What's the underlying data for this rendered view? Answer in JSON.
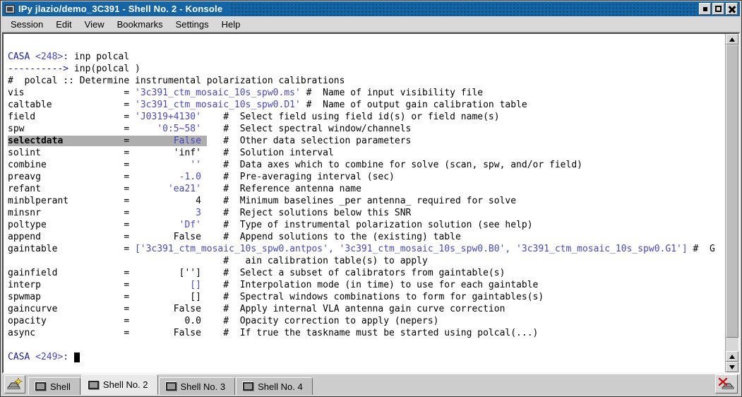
{
  "window": {
    "title": "IPy jlazio/demo_3C391 - Shell No. 2 - Konsole"
  },
  "menu": {
    "items": [
      "Session",
      "Edit",
      "View",
      "Bookmarks",
      "Settings",
      "Help"
    ]
  },
  "colors": {
    "titlebar_blue": "#1565a5",
    "prompt_navy": "#1c1c9e",
    "value_blue": "#4646c8",
    "highlight_gray": "#aeaeae",
    "terminal_bg": "#ffffff"
  },
  "terminal": {
    "lines": [
      {
        "segs": [
          {
            "t": "CASA ",
            "c": "p"
          },
          {
            "t": "<248>",
            "c": "n"
          },
          {
            "t": ": ",
            "c": "p"
          },
          {
            "t": "inp polcal",
            "c": "k"
          }
        ]
      },
      {
        "segs": [
          {
            "t": "----------> ",
            "c": "p"
          },
          {
            "t": "inp(polcal )",
            "c": "k"
          }
        ]
      },
      {
        "segs": [
          {
            "t": "#  polcal :: Determine instrumental polarization calibrations",
            "c": "k"
          }
        ]
      },
      {
        "segs": [
          {
            "t": "vis                  = ",
            "c": "k"
          },
          {
            "t": "'3c391_ctm_mosaic_10s_spw0.ms'",
            "c": "n"
          },
          {
            "t": " #  Name of input visibility file",
            "c": "k"
          }
        ]
      },
      {
        "segs": [
          {
            "t": "caltable             = ",
            "c": "k"
          },
          {
            "t": "'3c391_ctm_mosaic_10s_spw0.D1'",
            "c": "n"
          },
          {
            "t": " #  Name of output gain calibration table",
            "c": "k"
          }
        ]
      },
      {
        "segs": [
          {
            "t": "field                = ",
            "c": "k"
          },
          {
            "t": "'J0319+4130'",
            "c": "n"
          },
          {
            "t": "    #  Select field using field id(s) or field name(s)",
            "c": "k"
          }
        ]
      },
      {
        "segs": [
          {
            "t": "spw                  =     ",
            "c": "k"
          },
          {
            "t": "'0:5~58'",
            "c": "n"
          },
          {
            "t": "    #  Select spectral window/channels",
            "c": "k"
          }
        ]
      },
      {
        "segs": [
          {
            "t": "selectdata           ",
            "c": "b hl"
          },
          {
            "t": "=        ",
            "c": "k hl"
          },
          {
            "t": "False",
            "c": "n hl"
          },
          {
            "t": " ",
            "c": "k hl"
          },
          {
            "t": "   #  Other data selection parameters",
            "c": "k"
          }
        ]
      },
      {
        "segs": [
          {
            "t": "solint               =        'inf'    #  Solution interval",
            "c": "k"
          }
        ]
      },
      {
        "segs": [
          {
            "t": "combine              =           ",
            "c": "k"
          },
          {
            "t": "''",
            "c": "n"
          },
          {
            "t": "    #  Data axes which to combine for solve (scan, spw, and/or field)",
            "c": "k"
          }
        ]
      },
      {
        "segs": [
          {
            "t": "preavg               =         ",
            "c": "k"
          },
          {
            "t": "-1.0",
            "c": "n"
          },
          {
            "t": "    #  Pre-averaging interval (sec)",
            "c": "k"
          }
        ]
      },
      {
        "segs": [
          {
            "t": "refant               =       ",
            "c": "k"
          },
          {
            "t": "'ea21'",
            "c": "n"
          },
          {
            "t": "    #  Reference antenna name",
            "c": "k"
          }
        ]
      },
      {
        "segs": [
          {
            "t": "minblperant          =            4    #  Minimum baselines _per antenna_ required for solve",
            "c": "k"
          }
        ]
      },
      {
        "segs": [
          {
            "t": "minsnr               =            ",
            "c": "k"
          },
          {
            "t": "3",
            "c": "n"
          },
          {
            "t": "    #  Reject solutions below this SNR",
            "c": "k"
          }
        ]
      },
      {
        "segs": [
          {
            "t": "poltype              =         ",
            "c": "k"
          },
          {
            "t": "'Df'",
            "c": "n"
          },
          {
            "t": "    #  Type of instrumental polarization solution (see help)",
            "c": "k"
          }
        ]
      },
      {
        "segs": [
          {
            "t": "append               =        False    #  Append solutions to the (existing) table",
            "c": "k"
          }
        ]
      },
      {
        "segs": [
          {
            "t": "gaintable            = ",
            "c": "k"
          },
          {
            "t": "['3c391_ctm_mosaic_10s_spw0.antpos', '3c391_ctm_mosaic_10s_spw0.B0', '3c391_ctm_mosaic_10s_spw0.G1']",
            "c": "n"
          },
          {
            "t": " #  G",
            "c": "k"
          }
        ]
      },
      {
        "segs": [
          {
            "t": "                                       #   ain calibration table(s) to apply",
            "c": "k"
          }
        ]
      },
      {
        "segs": [
          {
            "t": "gainfield            =         ['']    #  Select a subset of calibrators from gaintable(s)",
            "c": "k"
          }
        ]
      },
      {
        "segs": [
          {
            "t": "interp               =           ",
            "c": "k"
          },
          {
            "t": "[]",
            "c": "n"
          },
          {
            "t": "    #  Interpolation mode (in time) to use for each gaintable",
            "c": "k"
          }
        ]
      },
      {
        "segs": [
          {
            "t": "spwmap               =           []    #  Spectral windows combinations to form for gaintables(s)",
            "c": "k"
          }
        ]
      },
      {
        "segs": [
          {
            "t": "gaincurve            =        False    #  Apply internal VLA antenna gain curve correction",
            "c": "k"
          }
        ]
      },
      {
        "segs": [
          {
            "t": "opacity              =          0.0    #  Opacity correction to apply (nepers)",
            "c": "k"
          }
        ]
      },
      {
        "segs": [
          {
            "t": "async                =        False    #  If true the taskname must be started using polcal(...)",
            "c": "k"
          }
        ]
      },
      {
        "segs": [
          {
            "t": " ",
            "c": "k"
          }
        ]
      },
      {
        "cursor": true,
        "segs": [
          {
            "t": "CASA ",
            "c": "p"
          },
          {
            "t": "<249>",
            "c": "n"
          },
          {
            "t": ": ",
            "c": "p"
          }
        ]
      }
    ]
  },
  "tabs": {
    "items": [
      {
        "label": "Shell",
        "active": false
      },
      {
        "label": "Shell No. 2",
        "active": true
      },
      {
        "label": "Shell No. 3",
        "active": false
      },
      {
        "label": "Shell No. 4",
        "active": false
      }
    ]
  }
}
